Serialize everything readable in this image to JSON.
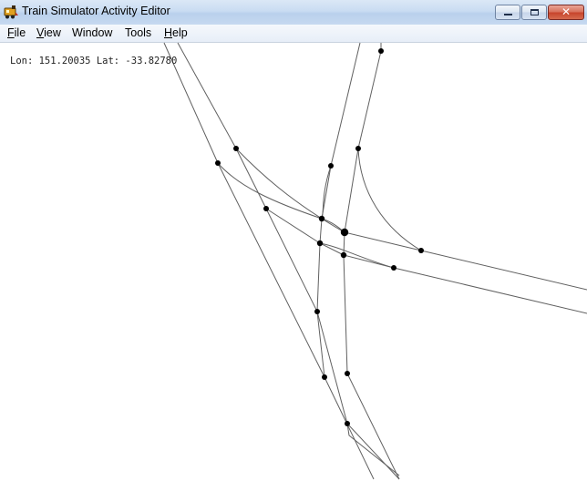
{
  "window": {
    "title": "Train Simulator Activity Editor",
    "icon": "train-app-icon"
  },
  "controls": {
    "minimize_icon": "minimize-icon",
    "maximize_icon": "maximize-icon",
    "close_glyph": "✕"
  },
  "menu": {
    "file": {
      "mnemonic": "F",
      "rest": "ile"
    },
    "view": {
      "mnemonic": "V",
      "rest": "iew"
    },
    "window": {
      "label": "Window"
    },
    "tools": {
      "label": "Tools"
    },
    "help": {
      "mnemonic": "H",
      "rest": "elp"
    }
  },
  "status": {
    "coordinates": "Lon: 151.20035 Lat: -33.82780"
  },
  "map": {
    "track_color": "#606060",
    "node_color": "#000000"
  }
}
